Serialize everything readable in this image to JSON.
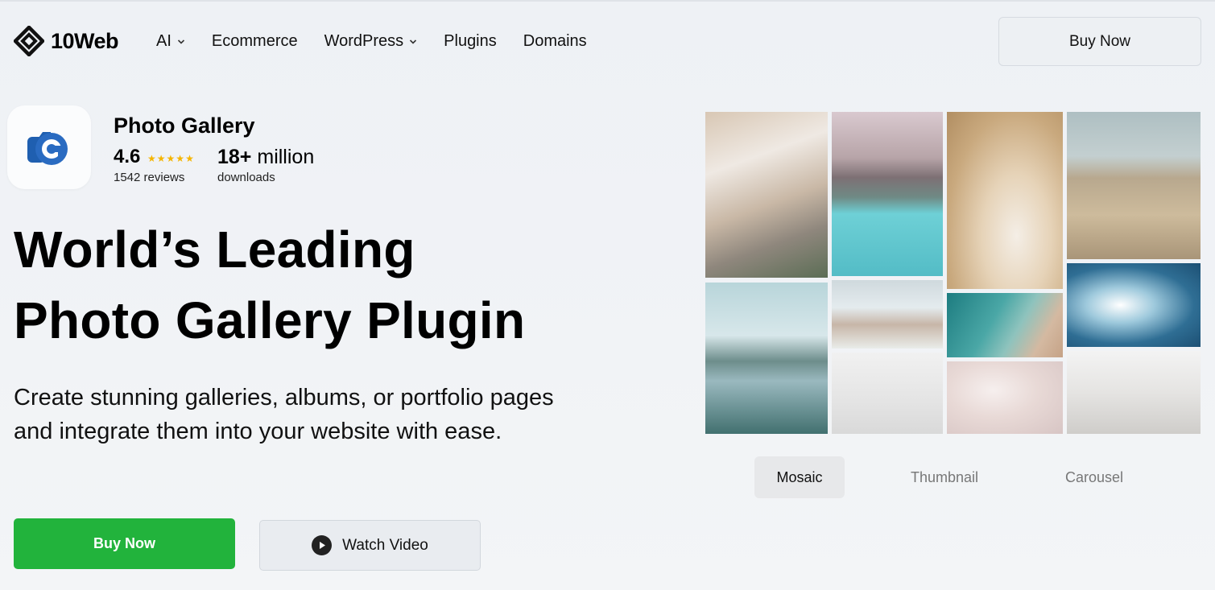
{
  "header": {
    "logo_text": "10Web",
    "nav": [
      {
        "label": "AI",
        "has_dropdown": true
      },
      {
        "label": "Ecommerce",
        "has_dropdown": false
      },
      {
        "label": "WordPress",
        "has_dropdown": true
      },
      {
        "label": "Plugins",
        "has_dropdown": false
      },
      {
        "label": "Domains",
        "has_dropdown": false
      }
    ],
    "buy_now_label": "Buy Now"
  },
  "plugin": {
    "name": "Photo Gallery",
    "rating": "4.6",
    "stars": 5,
    "reviews": "1542 reviews",
    "downloads_count": "18+",
    "downloads_unit": "million",
    "downloads_label": "downloads",
    "icon": "photo-gallery-camera-icon"
  },
  "hero": {
    "title_line1": "World’s Leading",
    "title_line2": "Photo Gallery Plugin",
    "subtitle_line1": "Create stunning galleries, albums, or portfolio pages",
    "subtitle_line2": "and integrate them into your website with ease.",
    "buy_label": "Buy Now",
    "watch_label": "Watch Video"
  },
  "gallery": {
    "tabs": [
      "Mosaic",
      "Thumbnail",
      "Carousel"
    ],
    "active_tab": "Mosaic"
  },
  "colors": {
    "accent_green": "#22b33c",
    "brand_blue": "#2a6bc1"
  }
}
